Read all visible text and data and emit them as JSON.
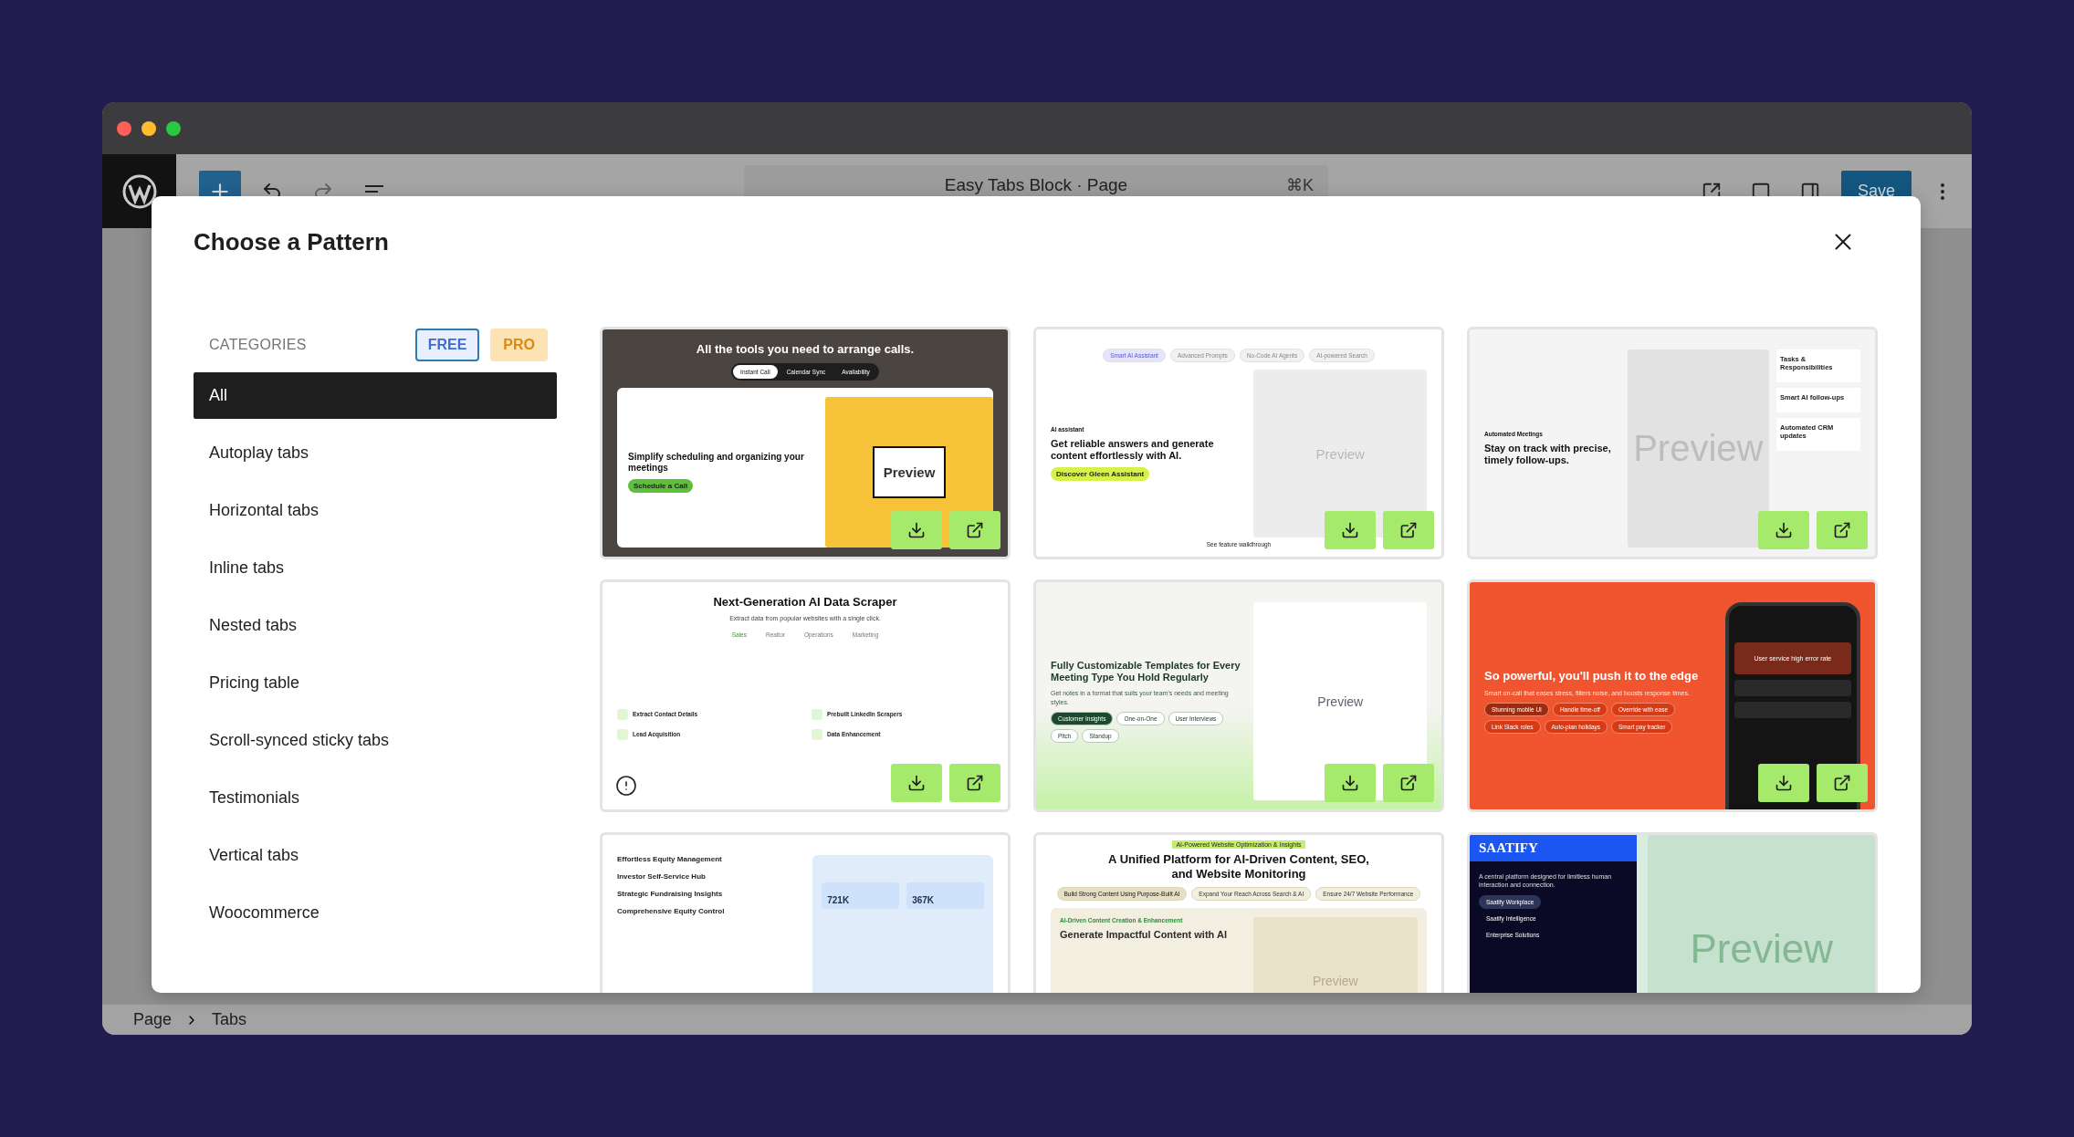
{
  "toolbar": {
    "document_title": "Easy Tabs Block · Page",
    "shortcut": "⌘K",
    "save_label": "Save"
  },
  "modal": {
    "title": "Choose a Pattern",
    "categories_label": "CATEGORIES",
    "filters": [
      {
        "label": "FREE",
        "selected": true
      },
      {
        "label": "PRO",
        "selected": false
      }
    ],
    "categories": [
      {
        "label": "All",
        "selected": true
      },
      {
        "label": "Autoplay tabs",
        "selected": false
      },
      {
        "label": "Horizontal tabs",
        "selected": false
      },
      {
        "label": "Inline tabs",
        "selected": false
      },
      {
        "label": "Nested tabs",
        "selected": false
      },
      {
        "label": "Pricing table",
        "selected": false
      },
      {
        "label": "Scroll-synced sticky tabs",
        "selected": false
      },
      {
        "label": "Testimonials",
        "selected": false
      },
      {
        "label": "Vertical tabs",
        "selected": false
      },
      {
        "label": "Woocommerce",
        "selected": false
      }
    ],
    "patterns": [
      {
        "kind": "dark",
        "top_heading": "All the tools you need to arrange calls.",
        "top_tabs": [
          {
            "label": "Instant Call",
            "selected": true
          },
          {
            "label": "Calendar Sync",
            "selected": false
          },
          {
            "label": "Availability",
            "selected": false
          }
        ],
        "heading": "Simplify scheduling and organizing your meetings",
        "cta": "Schedule a Call",
        "preview": "Preview",
        "actions": true
      },
      {
        "kind": "light",
        "top_tabs": [
          {
            "label": "Smart AI Assistant",
            "selected": true
          },
          {
            "label": "Advanced Prompts",
            "selected": false
          },
          {
            "label": "No-Code AI Agents",
            "selected": false
          },
          {
            "label": "AI-powered Search",
            "selected": false
          }
        ],
        "eyebrow": "AI assistant",
        "heading": "Get reliable answers and generate content effortlessly with AI.",
        "cta": "Discover Gleen Assistant",
        "preview": "Preview",
        "link": "See feature walkthrough",
        "actions": true
      },
      {
        "kind": "grey",
        "eyebrow": "Automated Meetings",
        "heading": "Stay on track with precise, timely follow-ups.",
        "preview": "Preview",
        "side_items": [
          "Tasks & Responsibilities",
          "Smart AI follow-ups",
          "Automated CRM updates"
        ],
        "actions": true
      },
      {
        "kind": "white",
        "top_heading": "Next-Generation AI Data Scraper",
        "top_sub": "Extract data from popular websites with a single click.",
        "top_tabs": [
          {
            "label": "Sales",
            "selected": true
          },
          {
            "label": "Realtor",
            "selected": false
          },
          {
            "label": "Operations",
            "selected": false
          },
          {
            "label": "Marketing",
            "selected": false
          }
        ],
        "items": [
          "Extract Contact Details",
          "Prebuilt LinkedIn Scrapers",
          "Lead Acquisition",
          "Data Enhancement"
        ],
        "info_icon": true,
        "actions": true
      },
      {
        "kind": "green",
        "heading": "Fully Customizable Templates for Every Meeting Type You Hold Regularly",
        "sub": "Get notes in a format that suits your team's needs and meeting styles.",
        "chips": [
          {
            "label": "Customer Insights",
            "selected": true
          },
          {
            "label": "One-on-One",
            "selected": false
          },
          {
            "label": "User Interviews",
            "selected": false
          },
          {
            "label": "Pitch",
            "selected": false
          },
          {
            "label": "Standup",
            "selected": false
          }
        ],
        "preview": "Preview",
        "actions": true
      },
      {
        "kind": "orange",
        "heading": "So powerful, you'll push it to the edge",
        "sub": "Smart on-call that eases stress, filters noise, and boosts response times.",
        "chips": [
          {
            "label": "Stunning mobile UI",
            "selected": true
          },
          {
            "label": "Handle time-off",
            "selected": false
          },
          {
            "label": "Override with ease",
            "selected": false
          },
          {
            "label": "Link Slack roles",
            "selected": false
          },
          {
            "label": "Auto-plan holidays",
            "selected": false
          },
          {
            "label": "Smart pay tracker",
            "selected": false
          }
        ],
        "phone_text": "User service high error rate",
        "actions": true
      },
      {
        "kind": "blue",
        "items": [
          "Effortless Equity Management",
          "Investor Self-Service Hub",
          "Strategic Fundraising Insights",
          "Comprehensive Equity Control"
        ],
        "stats": [
          "721K",
          "367K"
        ],
        "actions": false
      },
      {
        "kind": "beige",
        "top_eyebrow": "AI-Powered Website Optimization & Insights",
        "top_heading": "A Unified Platform for AI-Driven Content, SEO, and Website Monitoring",
        "top_tabs": [
          {
            "label": "Build Strong Content Using Purpose-Built AI",
            "selected": true
          },
          {
            "label": "Expand Your Reach Across Search & AI",
            "selected": false
          },
          {
            "label": "Ensure 24/7 Website Performance",
            "selected": false
          }
        ],
        "eyebrow": "AI-Driven Content Creation & Enhancement",
        "heading": "Generate Impactful Content with AI",
        "preview": "Preview",
        "actions": false
      },
      {
        "kind": "navy",
        "logo": "SAATIFY",
        "sub": "A central platform designed for limitless human interaction and connection.",
        "chips": [
          {
            "label": "Saatify Workplace",
            "selected": true
          },
          {
            "label": "Saatify Intelligence",
            "selected": false
          },
          {
            "label": "Enterprise Solutions",
            "selected": false
          }
        ],
        "preview": "Preview",
        "actions": false
      }
    ]
  },
  "breadcrumb": [
    "Page",
    "Tabs"
  ]
}
